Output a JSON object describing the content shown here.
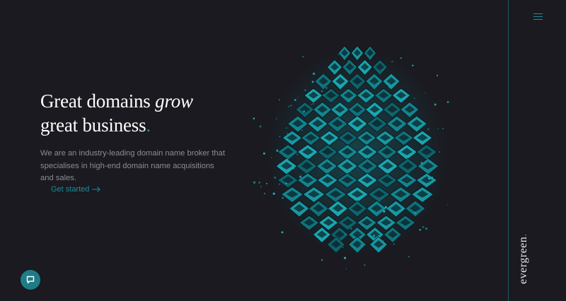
{
  "hero": {
    "headline_line1_a": "Great domains ",
    "headline_line1_b": "grow",
    "headline_line2": "great business",
    "headline_dot": ".",
    "description": "We are an industry-leading domain name broker that specialises in high-end domain name acquisitions and sales.",
    "cta_label": "Get started"
  },
  "rail": {
    "brand": "evergreen",
    "brand_dot": "."
  },
  "icons": {
    "menu": "hamburger-menu-icon",
    "cta_arrow": "arrow-right-icon",
    "chat": "chat-bubble-icon",
    "illustration": "pinecone-illustration"
  },
  "colors": {
    "background": "#1a1a20",
    "accent": "#1e8c98",
    "heading": "#ffffff",
    "body_text": "#8b8e96"
  }
}
